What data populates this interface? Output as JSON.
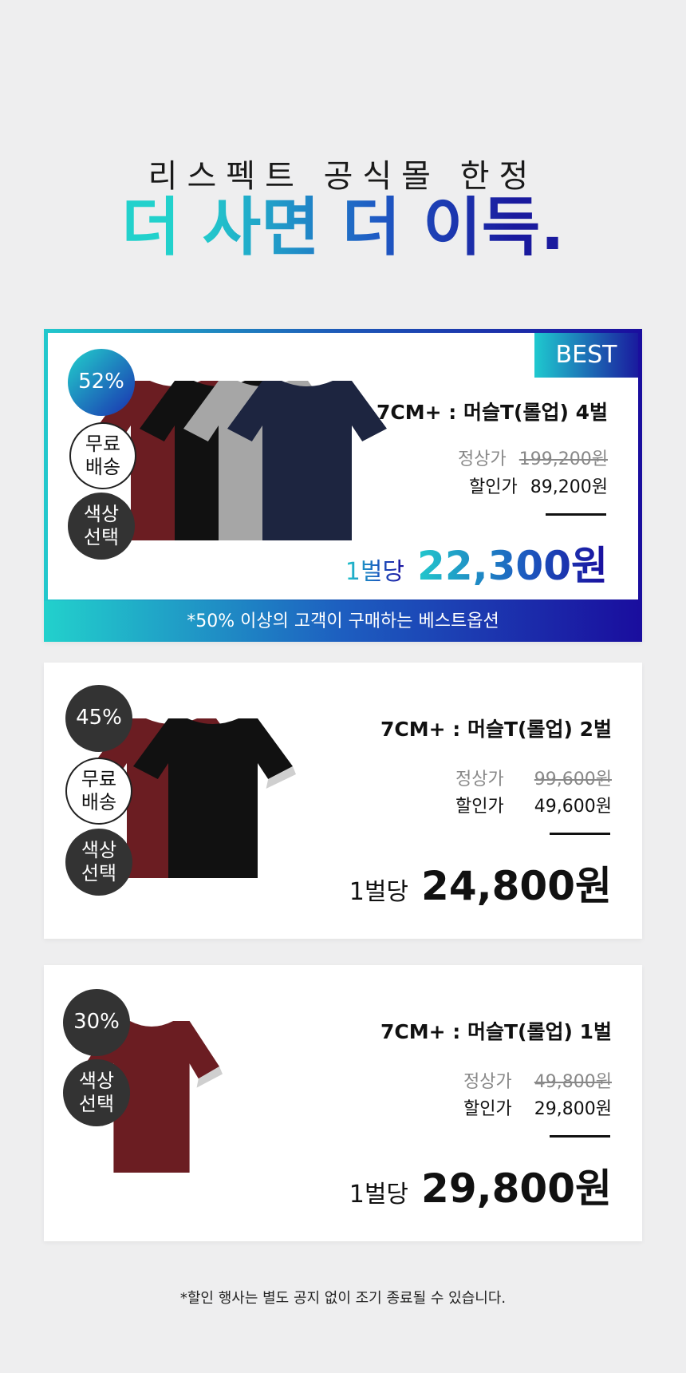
{
  "header": {
    "subtitle": "리스펙트 공식몰 한정",
    "headline": "더 사면 더 이득."
  },
  "products": [
    {
      "best_tag": "BEST",
      "discount": "52%",
      "free_ship": "무료\n배송",
      "color_select": "색상\n선택",
      "name": "7CM+ : 머슬T(롤업) 4벌",
      "regular_label": "정상가",
      "regular_price": "199,200원",
      "sale_label": "할인가",
      "sale_price": "89,200원",
      "unit_label": "1벌당",
      "unit_price": "22,300원",
      "banner": "*50% 이상의 고객이 구매하는 베스트옵션",
      "shirt_colors": [
        "#6b1d22",
        "#111111",
        "#a6a6a6",
        "#1d2540"
      ]
    },
    {
      "discount": "45%",
      "free_ship": "무료\n배송",
      "color_select": "색상\n선택",
      "name": "7CM+ : 머슬T(롤업) 2벌",
      "regular_label": "정상가",
      "regular_price": "99,600원",
      "sale_label": "할인가",
      "sale_price": "49,600원",
      "unit_label": "1벌당",
      "unit_price": "24,800원",
      "shirt_colors": [
        "#6b1d22",
        "#111111"
      ]
    },
    {
      "discount": "30%",
      "color_select": "색상\n선택",
      "name": "7CM+ : 머슬T(롤업) 1벌",
      "regular_label": "정상가",
      "regular_price": "49,800원",
      "sale_label": "할인가",
      "sale_price": "29,800원",
      "unit_label": "1벌당",
      "unit_price": "29,800원",
      "shirt_colors": [
        "#6b1d22"
      ]
    }
  ],
  "footer_note": "*할인 행사는 별도 공지 없이 조기 종료될 수 있습니다."
}
